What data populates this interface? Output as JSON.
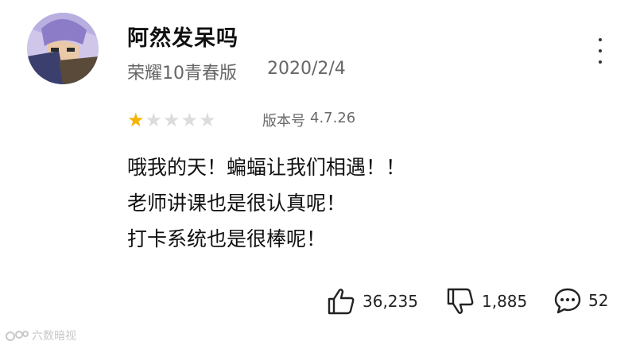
{
  "review": {
    "username": "阿然发呆吗",
    "device": "荣耀10青春版",
    "date": "2020/2/4",
    "rating": 1,
    "rating_max": 5,
    "version_label": "版本号",
    "version": "4.7.26",
    "lines": [
      "哦我的天！蝙蝠让我们相遇！！",
      "老师讲课也是很认真呢！",
      "打卡系统也是很棒呢！"
    ]
  },
  "actions": {
    "likes": "36,235",
    "dislikes": "1,885",
    "comments": "52"
  },
  "colors": {
    "star_filled": "#f5b400",
    "star_empty": "#dcdcdc",
    "text_secondary": "#666666"
  },
  "icons": [
    "more-vertical-icon",
    "star-icon",
    "thumbs-up-icon",
    "thumbs-down-icon",
    "comment-bubble-icon"
  ],
  "watermark": {
    "text": "六数暗视"
  }
}
